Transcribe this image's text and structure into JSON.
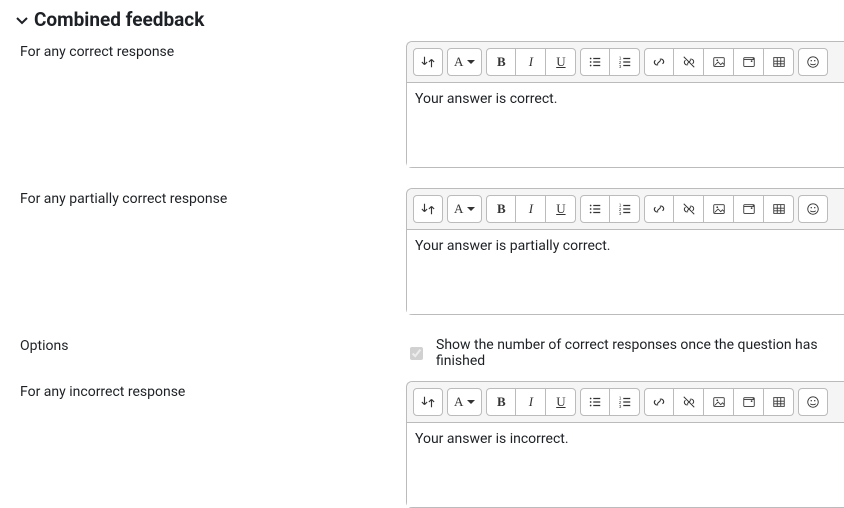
{
  "section": {
    "title": "Combined feedback"
  },
  "fields": {
    "correct": {
      "label": "For any correct response",
      "value": "Your answer is correct."
    },
    "partial": {
      "label": "For any partially correct response",
      "value": "Your answer is partially correct."
    },
    "incorrect": {
      "label": "For any incorrect response",
      "value": "Your answer is incorrect."
    },
    "options": {
      "label": "Options",
      "checkbox_label": "Show the number of correct responses once the question has finished",
      "checked": true
    }
  },
  "toolbar": {
    "font_label": "A",
    "bold": "B",
    "italic": "I",
    "underline": "U"
  }
}
